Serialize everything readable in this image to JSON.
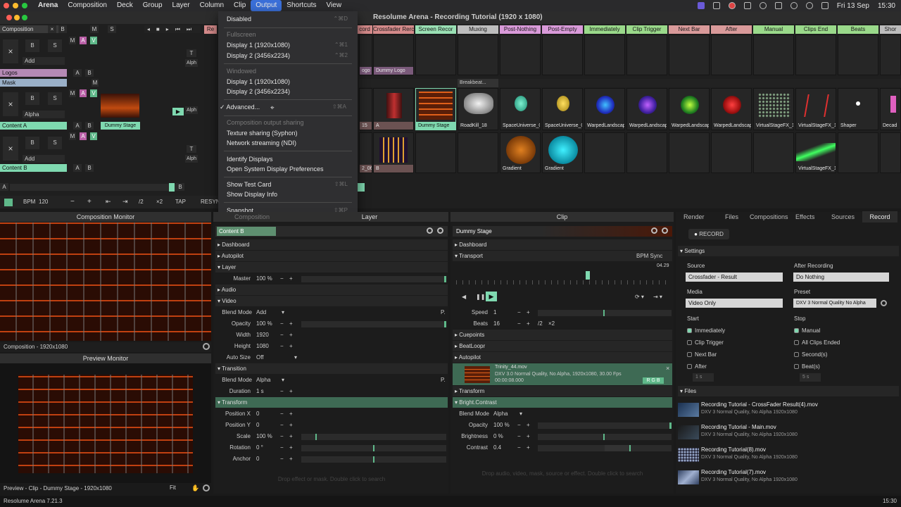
{
  "menubar": {
    "app": "Arena",
    "items": [
      "Composition",
      "Deck",
      "Group",
      "Layer",
      "Column",
      "Clip",
      "Output",
      "Shortcuts",
      "View"
    ],
    "active": "Output",
    "date": "Fri 13 Sep",
    "time": "15:30"
  },
  "window": {
    "title": "Resolume Arena - Recording Tutorial (1920 x 1080)"
  },
  "menu": {
    "items": [
      {
        "label": "Disabled",
        "shortcut": "⌃⌘D",
        "disabled": false
      },
      {
        "label": "Fullscreen",
        "disabled": true
      },
      {
        "label": "Display 1 (1920x1080)",
        "shortcut": "⌃⌘1"
      },
      {
        "label": "Display 2 (3456x2234)",
        "shortcut": "⌃⌘2"
      },
      {
        "label": "Windowed",
        "disabled": true
      },
      {
        "label": "Display 1 (1920x1080)"
      },
      {
        "label": "Display 2 (3456x2234)"
      },
      {
        "label": "✓ Advanced...",
        "shortcut": "⇧⌘A"
      },
      {
        "label": "Composition output sharing",
        "disabled": true
      },
      {
        "label": "Texture sharing (Syphon)"
      },
      {
        "label": "Network streaming (NDI)"
      },
      {
        "label": "Identify Displays"
      },
      {
        "label": "Open System Display Preferences"
      },
      {
        "label": "Show Test Card",
        "shortcut": "⇧⌘L"
      },
      {
        "label": "Show Display Info"
      },
      {
        "label": "Snapshot",
        "shortcut": "⇧⌘P"
      }
    ]
  },
  "composition": {
    "label": "Composition",
    "add": "Add",
    "b": "B",
    "s": "S",
    "m": "M",
    "a": "A",
    "v": "V",
    "t": "T",
    "alph": "Alph",
    "alpha": "Alpha"
  },
  "columns": [
    "Crossfader Rercord",
    "Screen Recor",
    "Muxing",
    "Post-Nothing",
    "Post-Empty",
    "Immediately",
    "Clip Trigger",
    "Next Bar",
    "After",
    "Manual",
    "Clips End",
    "Beats",
    "Shor"
  ],
  "col_colors": [
    "#d48a8a",
    "#9ae0b4",
    "#bdbdbd",
    "#d99ad9",
    "#d99ad9",
    "#9ad98a",
    "#9ad98a",
    "#d99a9a",
    "#d99a9a",
    "#9ad98a",
    "#9ad98a",
    "#9ad98a",
    "#bdbdbd"
  ],
  "layers": {
    "logos": "Logos",
    "mask": "Mask",
    "contentA": "Content A",
    "contentB": "Content B"
  },
  "row_logos": [
    "Dummy Logo"
  ],
  "row_a_clips": [
    "A",
    "Dummy Stage",
    "RoadKill_18",
    "SpaceUniverse_03",
    "SpaceUniverse_03",
    "WarpedLandscap...",
    "WarpedLandscap...",
    "WarpedLandscap...",
    "WarpedLandscap...",
    "VirtualStageFX_15",
    "VirtualStageFX_14",
    "Shaper",
    "Decad"
  ],
  "row_b_clips": [
    "B",
    "",
    "",
    "Gradient",
    "Gradient",
    "",
    "",
    "",
    "",
    "VirtualStageFX_17",
    "",
    "",
    ""
  ],
  "layer_clip_a": "Dummy Stage",
  "partial_clip_labels": {
    "left_a": "15",
    "left_b": "2_06",
    "logo_partial": "ogo",
    "mask_breakbeat": "Breakbeat..."
  },
  "transport": {
    "bpm_label": "BPM",
    "bpm": "120",
    "tap": "TAP",
    "resync": "RESYN",
    "half": "/2",
    "double": "×2",
    "minus": "−",
    "plus": "+"
  },
  "comp_monitor": {
    "title": "Composition Monitor",
    "footer": "Composition - 1920x1080"
  },
  "preview_monitor": {
    "title": "Preview Monitor",
    "footer": "Preview - Clip - Dummy Stage - 1920x1080",
    "fit": "Fit"
  },
  "layer_panel": {
    "tab": "Composition",
    "title": "Layer",
    "name": "Content B",
    "sections": [
      "Dashboard",
      "Autopilot",
      "Layer"
    ],
    "master_label": "Master",
    "master": "100 %",
    "audio": "Audio",
    "video": "Video",
    "blend_label": "Blend Mode",
    "blend": "Add",
    "opacity_label": "Opacity",
    "opacity": "100 %",
    "width_label": "Width",
    "width": "1920",
    "height_label": "Height",
    "height": "1080",
    "autosize_label": "Auto Size",
    "autosize": "Off",
    "transition": "Transition",
    "tblend_label": "Blend Mode",
    "tblend": "Alpha",
    "duration_label": "Duration",
    "duration": "1 s",
    "transform": "Transform",
    "posx_label": "Position X",
    "posx": "0",
    "posy_label": "Position Y",
    "posy": "0",
    "scale_label": "Scale",
    "scale": "100 %",
    "rotation_label": "Rotation",
    "rotation": "0 °",
    "anchor_label": "Anchor",
    "anchor": "0",
    "drop": "Drop effect or mask. Double click to search"
  },
  "clip_panel": {
    "title": "Clip",
    "name": "Dummy Stage",
    "dashboard": "Dashboard",
    "transport": "Transport",
    "bpm_sync": "BPM Sync",
    "time": "04.29",
    "speed_label": "Speed",
    "speed": "1",
    "beats_label": "Beats",
    "beats": "16",
    "cuepoints": "Cuepoints",
    "beatloopr": "BeatLoopr",
    "autopilot": "Autopilot",
    "file": "Trinity_44.mov",
    "file_info": "DXV 3.0 Normal Quality, No Alpha, 1920x1080, 30.00 Fps",
    "file_time": "00:00:08.000",
    "transform": "Transform",
    "bc": "Bright.Contrast",
    "blend_label": "Blend Mode",
    "blend": "Alpha",
    "opacity_label": "Opacity",
    "opacity": "100 %",
    "brightness_label": "Brightness",
    "brightness": "0 %",
    "contrast_label": "Contrast",
    "contrast": "0.4",
    "drop": "Drop audio, video, mask, source or effect. Double click to search"
  },
  "right_tabs": [
    "Render",
    "Files",
    "Compositions",
    "Effects",
    "Sources",
    "Record"
  ],
  "record": {
    "button": "RECORD",
    "settings": "Settings",
    "source_label": "Source",
    "source": "Crossfader - Result",
    "after_label": "After Recording",
    "after": "Do Nothing",
    "media_label": "Media",
    "media": "Video Only",
    "preset_label": "Preset",
    "preset": "DXV 3 Normal Quality No Alpha",
    "start_label": "Start",
    "stop_label": "Stop",
    "start_opts": [
      "Immediately",
      "Clip Trigger",
      "Next Bar",
      "After"
    ],
    "stop_opts": [
      "Manual",
      "All Clips Ended",
      "Second(s)",
      "Beat(s)"
    ],
    "start_val": "1 s",
    "stop_val": "5 s",
    "files_label": "Files",
    "files": [
      {
        "name": "Recording Tutorial - CrossFader Result(4).mov",
        "info": "DXV 3 Normal Quality, No Alpha 1920x1080"
      },
      {
        "name": "Recording Tutorial - Main.mov",
        "info": "DXV 3 Normal Quality, No Alpha 1920x1080"
      },
      {
        "name": "Recording Tutorial(8).mov",
        "info": "DXV 3 Normal Quality, No Alpha 1920x1080"
      },
      {
        "name": "Recording Tutorial(7).mov",
        "info": "DXV 3 Normal Quality, No Alpha 1920x1080"
      }
    ]
  },
  "status": {
    "version": "Resolume Arena 7.21.3",
    "time": "15:30"
  },
  "colors": {
    "accent": "#7fd9b0",
    "layerA": "#7fd9b0",
    "logos": "#b58ab5",
    "mask": "#9ab0c8"
  }
}
